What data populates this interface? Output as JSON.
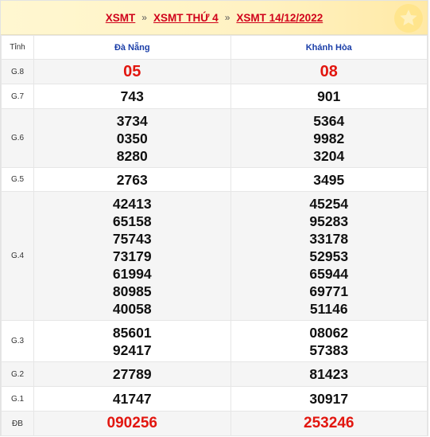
{
  "breadcrumb": {
    "items": [
      "XSMT",
      "XSMT THỨ 4",
      "XSMT 14/12/2022"
    ],
    "separator": "»"
  },
  "decor": {
    "icon": "star-icon"
  },
  "table": {
    "label_header": "Tỉnh",
    "provinces": [
      "Đà Nẵng",
      "Khánh Hòa"
    ],
    "rows": [
      {
        "label": "G.8",
        "a": [
          "05"
        ],
        "b": [
          "08"
        ]
      },
      {
        "label": "G.7",
        "a": [
          "743"
        ],
        "b": [
          "901"
        ]
      },
      {
        "label": "G.6",
        "a": [
          "3734",
          "0350",
          "8280"
        ],
        "b": [
          "5364",
          "9982",
          "3204"
        ]
      },
      {
        "label": "G.5",
        "a": [
          "2763"
        ],
        "b": [
          "3495"
        ]
      },
      {
        "label": "G.4",
        "a": [
          "42413",
          "65158",
          "75743",
          "73179",
          "61994",
          "80985",
          "40058"
        ],
        "b": [
          "45254",
          "95283",
          "33178",
          "52953",
          "65944",
          "69771",
          "51146"
        ]
      },
      {
        "label": "G.3",
        "a": [
          "85601",
          "92417"
        ],
        "b": [
          "08062",
          "57383"
        ]
      },
      {
        "label": "G.2",
        "a": [
          "27789"
        ],
        "b": [
          "81423"
        ]
      },
      {
        "label": "G.1",
        "a": [
          "41747"
        ],
        "b": [
          "30917"
        ]
      },
      {
        "label": "ĐB",
        "a": [
          "090256"
        ],
        "b": [
          "253246"
        ]
      }
    ]
  },
  "colors": {
    "accent": "#d0021b",
    "prize_red": "#e2160f",
    "province": "#1a3ea8"
  }
}
